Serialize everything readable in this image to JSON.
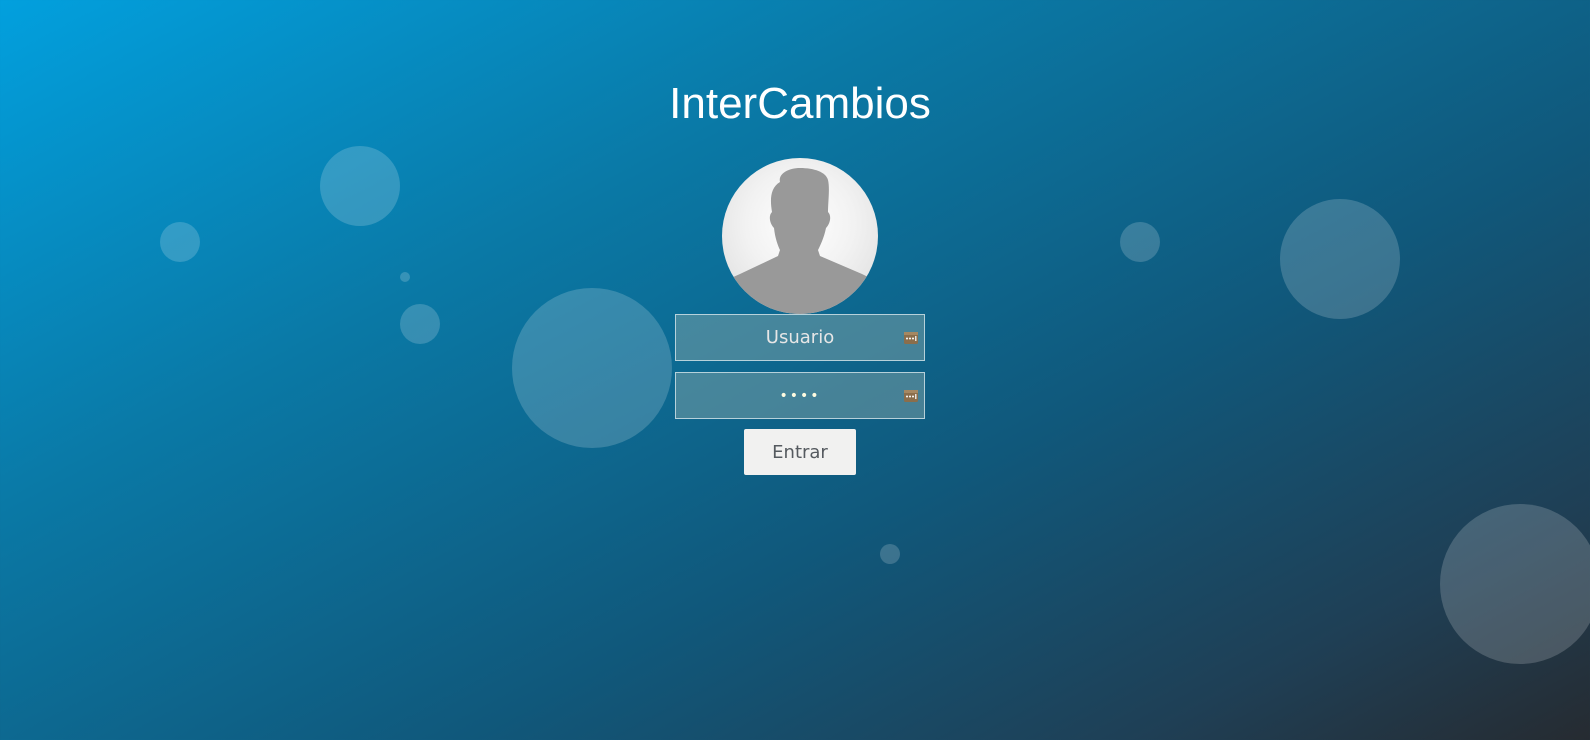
{
  "app": {
    "title": "InterCambios"
  },
  "login_form": {
    "username": {
      "placeholder": "Usuario",
      "value": ""
    },
    "password": {
      "value": "••••"
    },
    "submit_label": "Entrar"
  },
  "icons": {
    "avatar": "user-silhouette-icon",
    "username_field_icon": "password-manager-key-icon",
    "password_field_icon": "password-manager-key-icon"
  },
  "colors": {
    "background_start": "#02a0de",
    "background_end": "#262b31",
    "title": "#ffffff",
    "button_background": "#f1f1f0",
    "button_text": "#555a5f",
    "avatar_silhouette": "#999999"
  }
}
